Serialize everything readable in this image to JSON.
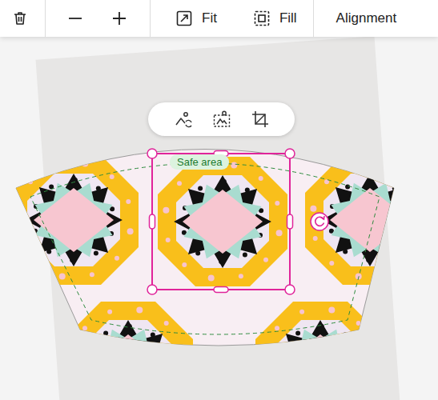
{
  "toolbar": {
    "groups": [
      {
        "buttons": [
          {
            "kind": "delete"
          }
        ]
      },
      {
        "buttons": [
          {
            "kind": "zoom-out"
          },
          {
            "kind": "zoom-in"
          }
        ]
      },
      {
        "buttons": [
          {
            "kind": "fit",
            "label": "Fit"
          },
          {
            "kind": "fill",
            "label": "Fill"
          }
        ]
      },
      {
        "buttons": [
          {
            "kind": "alignment",
            "label": "Alignment"
          }
        ]
      }
    ]
  },
  "canvas": {
    "safe_area": {
      "label": "Safe area"
    },
    "selection": {
      "selected": true
    },
    "context_toolbar": {
      "buttons": [
        {
          "kind": "replace-image"
        },
        {
          "kind": "remove-background"
        },
        {
          "kind": "crop"
        }
      ]
    }
  }
}
